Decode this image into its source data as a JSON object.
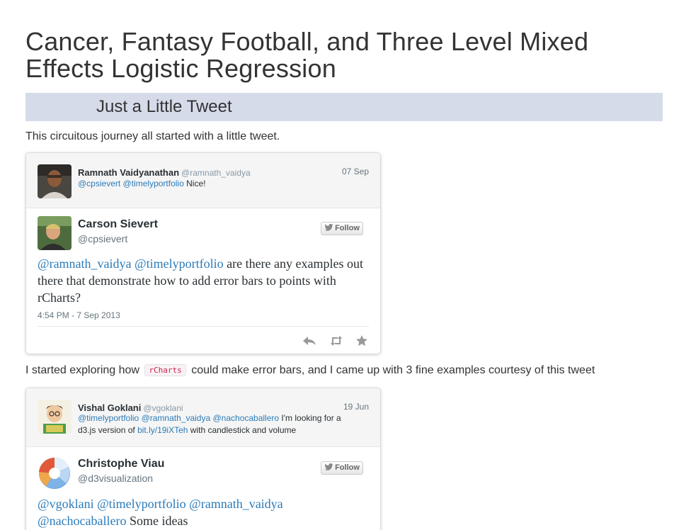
{
  "page": {
    "title": "Cancer, Fantasy Football, and Three Level Mixed Effects Logistic Regression",
    "section_heading": "Just a Little Tweet",
    "intro_text": "This circuitous journey all started with a little tweet.",
    "middle_text_before": "I started exploring how",
    "code_chip": "rCharts",
    "middle_text_after": "could make error bars, and I came up with 3 fine examples courtesy of this tweet"
  },
  "tweet1": {
    "reply": {
      "name": "Ramnath Vaidyanathan",
      "handle": "@ramnath_vaidya",
      "date": "07 Sep",
      "mention1": "@cpsievert",
      "mention2": "@timelyportfolio",
      "text": "Nice!"
    },
    "main": {
      "name": "Carson Sievert",
      "handle": "@cpsievert",
      "follow_label": "Follow",
      "mention1": "@ramnath_vaidya",
      "mention2": "@timelyportfolio",
      "text": "are there any examples out there that demonstrate how to add error bars to points with rCharts?",
      "timestamp": "4:54 PM - 7 Sep 2013"
    },
    "actions": [
      "reply-icon",
      "retweet-icon",
      "favorite-icon"
    ]
  },
  "tweet2": {
    "reply": {
      "name": "Vishal Goklani",
      "handle": "@vgoklani",
      "date": "19 Jun",
      "mention1": "@timelyportfolio",
      "mention2": "@ramnath_vaidya",
      "mention3": "@nachocaballero",
      "text1": "I'm looking for a",
      "text2": "d3.js version of",
      "link": "bit.ly/19iXTeh",
      "text3": "with candlestick and volume"
    },
    "main": {
      "name": "Christophe Viau",
      "handle": "@d3visualization",
      "follow_label": "Follow",
      "mention1": "@vgoklani",
      "mention2": "@timelyportfolio",
      "mention3": "@ramnath_vaidya",
      "mention4": "@nachocaballero",
      "text": "Some ideas"
    }
  },
  "colors": {
    "section_band": "#d6dbea",
    "mention": "#2b7bb9",
    "code_text": "#c7254e"
  }
}
